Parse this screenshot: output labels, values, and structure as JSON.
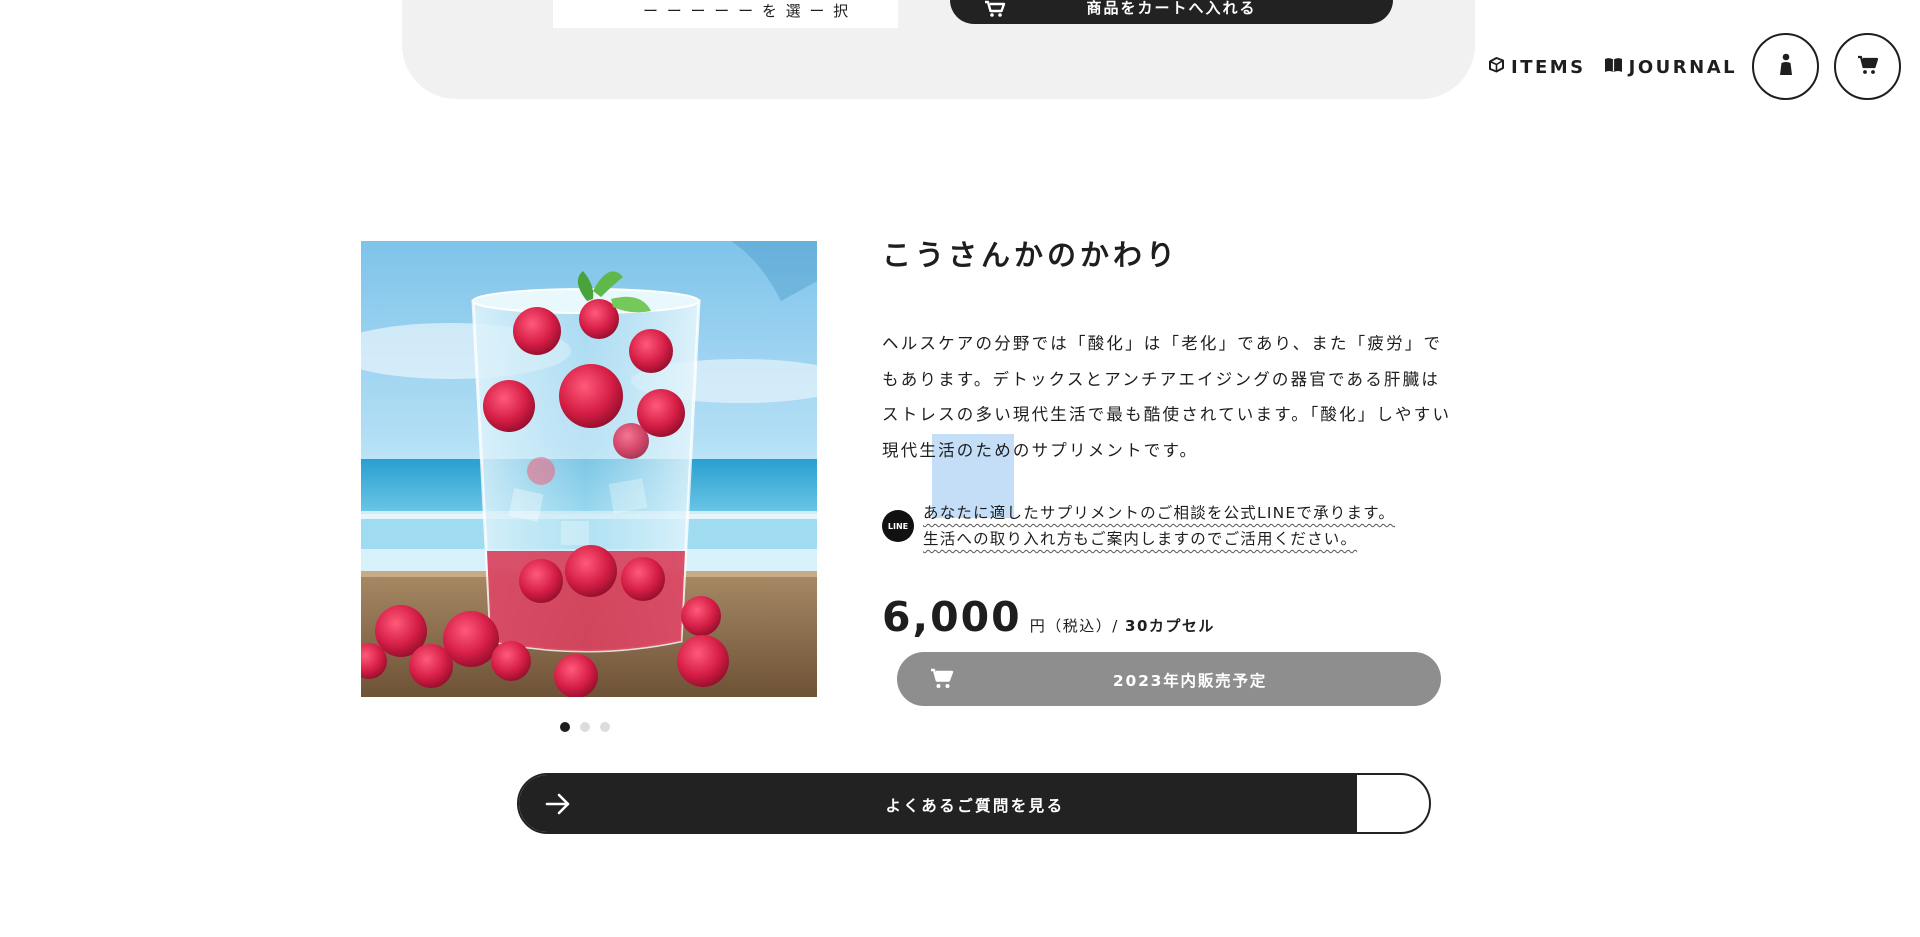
{
  "top_panel": {
    "select_text": "ー ー ー ー ー を 選 ー 択",
    "add_to_cart_label": "商品をカートへ入れる"
  },
  "header": {
    "nav": [
      {
        "label": "ITEMS",
        "icon": "cube-icon"
      },
      {
        "label": "JOURNAL",
        "icon": "book-icon"
      }
    ],
    "account_icon": "person-icon",
    "cart_icon": "cart-icon"
  },
  "product": {
    "title": "こうさんかのかわり",
    "description": "ヘルスケアの分野では「酸化」は「老化」であり、また「疲労」でもあります。デトックスとアンチアエイジングの器官である肝臓はストレスの多い現代生活で最も酷使されています。「酸化」しやすい現代生活のためのサプリメントです。",
    "line_icon_text": "LINE",
    "line_consult_1": "あなたに適したサプリメントのご相談を公式LINEで承ります。",
    "line_consult_2": "生活への取り入れ方もご案内しますのでご活用ください。",
    "price": "6,000",
    "price_unit": "円（税込）/",
    "capsules": "30カプセル",
    "preorder_label": "2023年内販売予定",
    "image_slides": 3,
    "active_slide": 1
  },
  "faq_button": {
    "label": "よくあるご質問を見る"
  },
  "colors": {
    "text": "#1e1e1e",
    "dark_button": "#222222",
    "disabled_button": "#8e8e8e",
    "panel_bg": "#f1f1f1",
    "selection": "#b9d8f5"
  }
}
